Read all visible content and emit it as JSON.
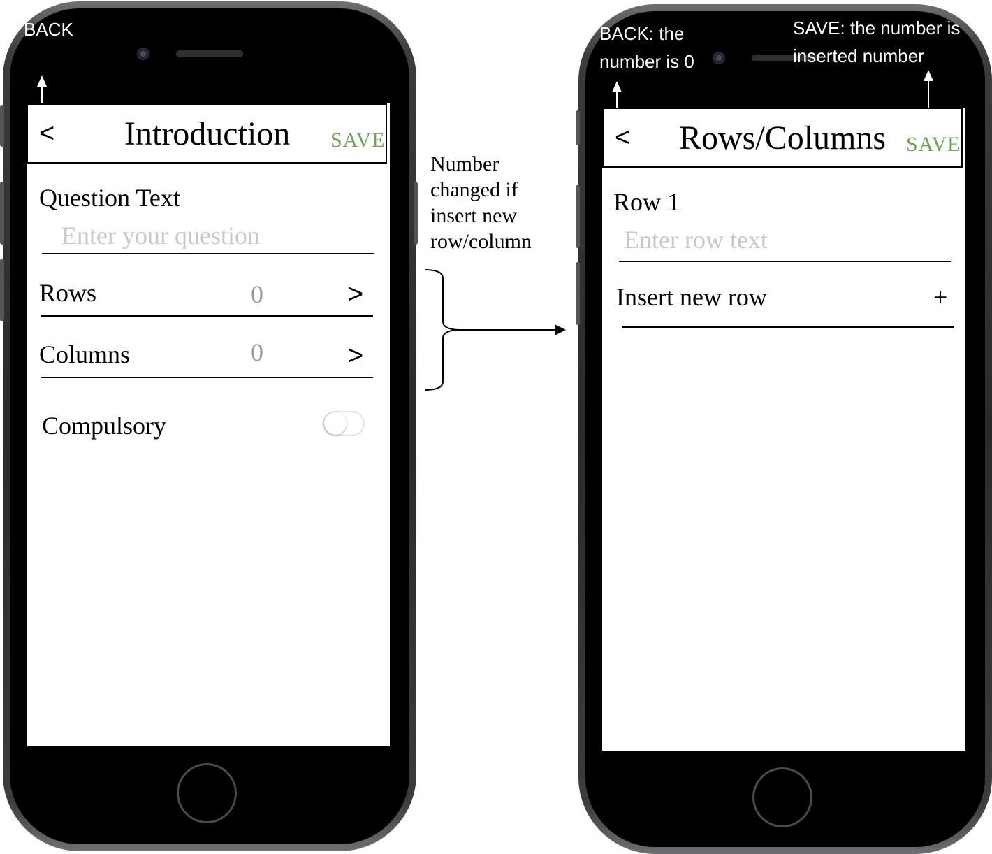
{
  "screen1": {
    "back_label": "<",
    "title": "Introduction",
    "save_label": "SAVE",
    "question_label": "Question Text",
    "question_placeholder": "Enter your question",
    "rows_label": "Rows",
    "rows_value": "0",
    "columns_label": "Columns",
    "columns_value": "0",
    "chevron": ">",
    "compulsory_label": "Compulsory",
    "compulsory_on": false
  },
  "screen2": {
    "back_label": "<",
    "title": "Rows/Columns",
    "save_label": "SAVE",
    "row_label": "Row 1",
    "row_placeholder": "Enter row text",
    "insert_label": "Insert new row",
    "insert_icon": "+"
  },
  "annotations": {
    "back1": "BACK",
    "back2_line1": "BACK: the",
    "back2_line2": "number is 0",
    "save2_line1": "SAVE: the number is",
    "save2_line2": "inserted number",
    "middle_lines": [
      "Number",
      "changed if",
      "insert new",
      "row/column"
    ]
  },
  "colors": {
    "save_green": "#6aa84f",
    "placeholder_gray": "#c8c8c8"
  }
}
